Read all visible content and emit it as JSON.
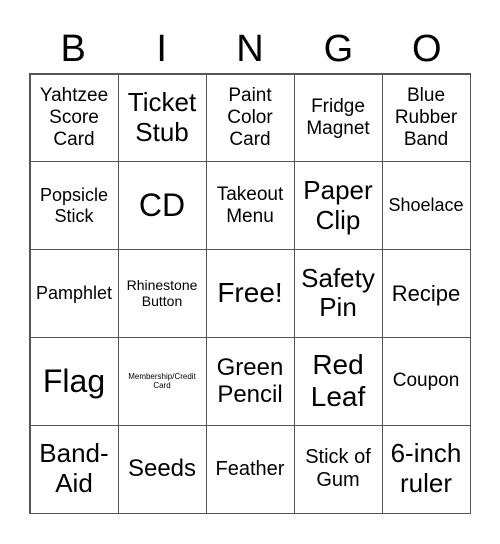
{
  "header": [
    "B",
    "I",
    "N",
    "G",
    "O"
  ],
  "cells": [
    [
      "Yahtzee Score Card",
      "Ticket Stub",
      "Paint Color Card",
      "Fridge Magnet",
      "Blue Rubber Band"
    ],
    [
      "Popsicle Stick",
      "CD",
      "Takeout Menu",
      "Paper Clip",
      "Shoelace"
    ],
    [
      "Pamphlet",
      "Rhinestone Button",
      "Free!",
      "Safety Pin",
      "Recipe"
    ],
    [
      "Flag",
      "Membership/Credit Card",
      "Green Pencil",
      "Red Leaf",
      "Coupon"
    ],
    [
      "Band-Aid",
      "Seeds",
      "Feather",
      "Stick of Gum",
      "6-inch ruler"
    ]
  ]
}
